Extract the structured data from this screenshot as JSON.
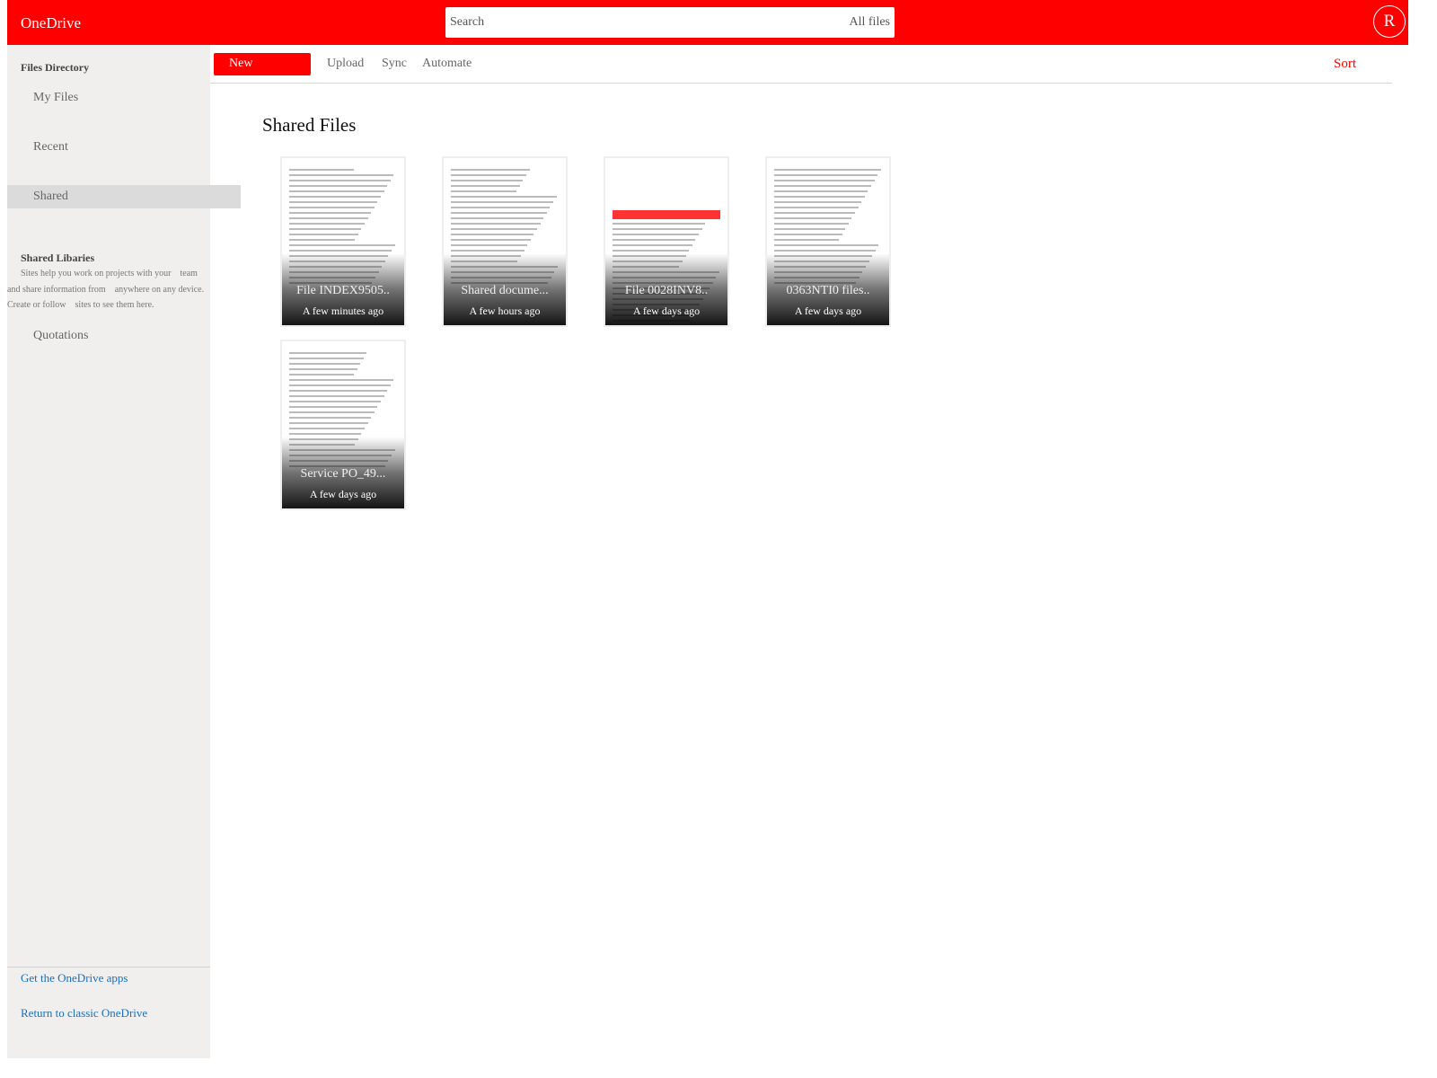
{
  "header": {
    "brand": "OneDrive",
    "search_placeholder": "Search",
    "search_scope": "All files",
    "avatar_initial": "R",
    "accent": "#ff0000"
  },
  "sidebar": {
    "files_heading": "Files Directory",
    "items": [
      {
        "label": "My Files"
      },
      {
        "label": "Recent"
      },
      {
        "label": "Shared",
        "active": true
      }
    ],
    "libraries_heading": "Shared Libaries",
    "libraries_desc": [
      "Sites help you work on projects with your    team",
      "and share information from    anywhere on any device.",
      "Create or follow    sites to see them here."
    ],
    "quotations": "Quotations",
    "footer_links": [
      "Get the OneDrive apps",
      "Return to classic OneDrive"
    ]
  },
  "toolbar": {
    "new": "New",
    "upload": "Upload",
    "sync": "Sync",
    "automate": "Automate",
    "sort": "Sort"
  },
  "main": {
    "title": "Shared Files",
    "files": [
      {
        "name": "File INDEX9505..",
        "time": "A few minutes ago"
      },
      {
        "name": "Shared docume...",
        "time": "A few hours ago"
      },
      {
        "name": "File 0028INV8..",
        "time": "A few days ago"
      },
      {
        "name": "0363NTI0 files..",
        "time": "A few days ago"
      },
      {
        "name": "Service PO_49...",
        "time": "A few days ago"
      }
    ]
  }
}
